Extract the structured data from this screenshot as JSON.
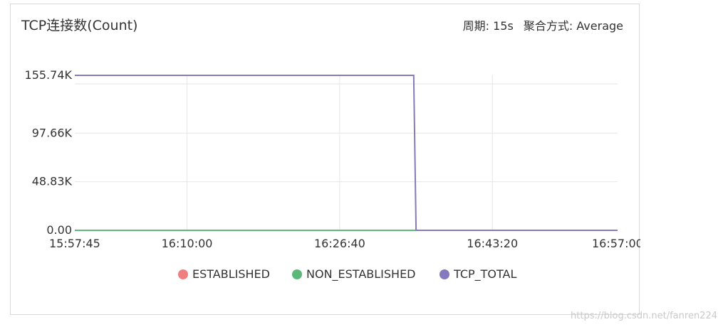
{
  "header": {
    "title": "TCP连接数(Count)",
    "period_label": "周期: 15s",
    "aggregation_label": "聚合方式: Average"
  },
  "colors": {
    "ESTABLISHED": "#f08080",
    "NON_ESTABLISHED": "#5cb87a",
    "TCP_TOTAL": "#8679be",
    "grid": "#e6e6e6"
  },
  "watermark": "https://blog.csdn.net/fanren224",
  "chart_data": {
    "type": "line",
    "title": "TCP连接数(Count)",
    "x_tick_labels": [
      "15:57:45",
      "16:10:00",
      "16:26:40",
      "16:43:20",
      "16:57:00"
    ],
    "y_tick_labels": [
      "0.00",
      "48.83K",
      "97.66K",
      "155.74K"
    ],
    "ylim": [
      0,
      155740
    ],
    "y_ticks": [
      0,
      48830,
      97660,
      155740
    ],
    "x_range": [
      "15:57:45",
      "16:57:00"
    ],
    "grid": true,
    "legend_position": "bottom",
    "series": [
      {
        "name": "ESTABLISHED",
        "points": [
          [
            "15:57:45",
            0
          ],
          [
            "16:57:00",
            0
          ]
        ]
      },
      {
        "name": "NON_ESTABLISHED",
        "points": [
          [
            "15:57:45",
            0
          ],
          [
            "16:57:00",
            0
          ]
        ]
      },
      {
        "name": "TCP_TOTAL",
        "points": [
          [
            "15:57:45",
            155740
          ],
          [
            "16:34:45",
            155740
          ],
          [
            "16:35:00",
            0
          ],
          [
            "16:57:00",
            0
          ]
        ]
      }
    ]
  }
}
